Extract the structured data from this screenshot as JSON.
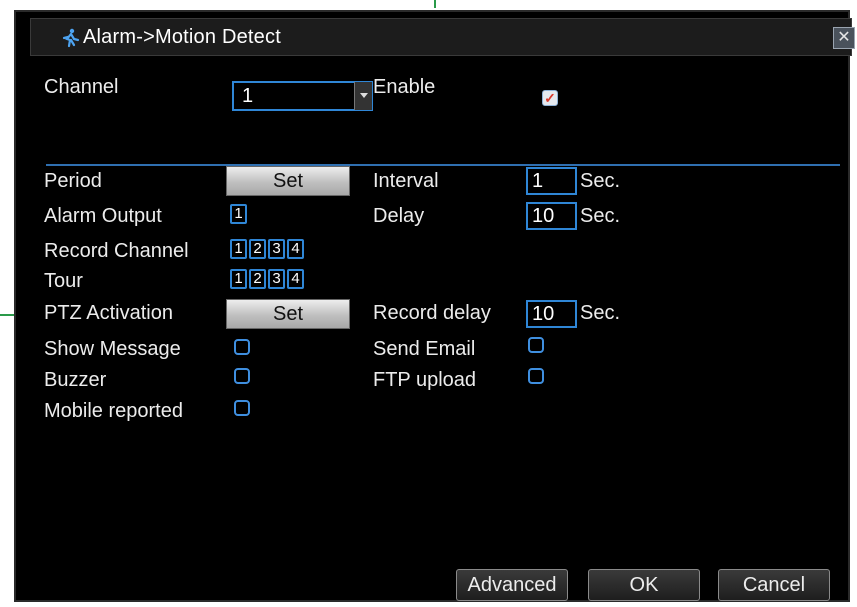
{
  "window": {
    "title": "Alarm->Motion Detect",
    "close": "✕"
  },
  "channel": {
    "label": "Channel",
    "value": "1"
  },
  "enable": {
    "label": "Enable",
    "checked": true
  },
  "period": {
    "label": "Period",
    "button": "Set"
  },
  "interval": {
    "label": "Interval",
    "value": "1",
    "unit": "Sec."
  },
  "alarm_output": {
    "label": "Alarm Output",
    "channels": [
      "1"
    ]
  },
  "delay": {
    "label": "Delay",
    "value": "10",
    "unit": "Sec."
  },
  "record_channel": {
    "label": "Record Channel",
    "channels": [
      "1",
      "2",
      "3",
      "4"
    ]
  },
  "tour": {
    "label": "Tour",
    "channels": [
      "1",
      "2",
      "3",
      "4"
    ]
  },
  "ptz": {
    "label": "PTZ Activation",
    "button": "Set"
  },
  "record_delay": {
    "label": "Record delay",
    "value": "10",
    "unit": "Sec."
  },
  "show_message": {
    "label": "Show Message",
    "checked": false
  },
  "send_email": {
    "label": "Send Email",
    "checked": false
  },
  "buzzer": {
    "label": "Buzzer",
    "checked": false
  },
  "ftp_upload": {
    "label": "FTP upload",
    "checked": false
  },
  "mobile_reported": {
    "label": "Mobile reported",
    "checked": false
  },
  "footer": {
    "advanced": "Advanced",
    "ok": "OK",
    "cancel": "Cancel"
  },
  "colors": {
    "accent": "#2f86d6",
    "background": "#000000",
    "text": "#ececec"
  }
}
